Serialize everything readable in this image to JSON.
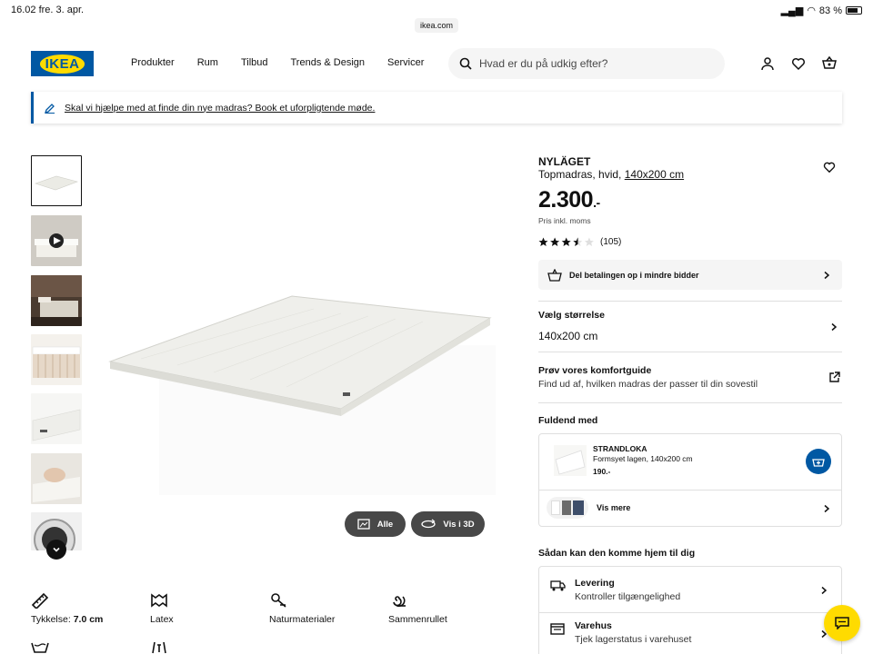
{
  "status": {
    "time_date": "16.02  fre. 3. apr.",
    "url": "ikea.com",
    "battery": "83 %"
  },
  "header": {
    "logo": "IKEA",
    "nav": [
      "Produkter",
      "Rum",
      "Tilbud",
      "Trends & Design",
      "Servicer"
    ],
    "search_placeholder": "Hvad er du på udkig efter?"
  },
  "banner": {
    "text": "Skal vi hjælpe med at finde din nye madras? Book et uforpligtende møde."
  },
  "gallery": {
    "buttons": {
      "all": "Alle",
      "view3d": "Vis i 3D"
    }
  },
  "product": {
    "name": "NYLÄGET",
    "desc_prefix": "Topmadras, hvid, ",
    "size_link": "140x200 cm",
    "price": "2.300",
    "price_suffix": ".-",
    "price_note": "Pris inkl. moms",
    "rating_value": 3.5,
    "rating_count": "(105)",
    "pay_text": "Del betalingen op i mindre bidder"
  },
  "size": {
    "title": "Vælg størrelse",
    "value": "140x200 cm"
  },
  "comfort": {
    "title": "Prøv vores komfortguide",
    "text": "Find ud af, hvilken madras der passer til din sovestil"
  },
  "complete": {
    "title": "Fuldend med",
    "item_name": "STRANDLOKA",
    "item_desc": "Formsyet lagen, 140x200 cm",
    "item_price": "190.-",
    "see_more": "Vis mere"
  },
  "delivery": {
    "title": "Sådan kan den komme hjem til dig",
    "options": [
      {
        "title": "Levering",
        "text": "Kontroller tilgængelighed"
      },
      {
        "title": "Varehus",
        "text": "Tjek lagerstatus i varehuset"
      }
    ]
  },
  "features": [
    {
      "label": "Tykkelse: ",
      "value": "7.0 cm"
    },
    {
      "label": "Latex",
      "value": ""
    },
    {
      "label": "Naturmaterialer",
      "value": ""
    },
    {
      "label": "Sammenrullet",
      "value": ""
    }
  ],
  "colors": {
    "brand_blue": "#0058a3",
    "brand_yellow": "#ffdb00"
  }
}
